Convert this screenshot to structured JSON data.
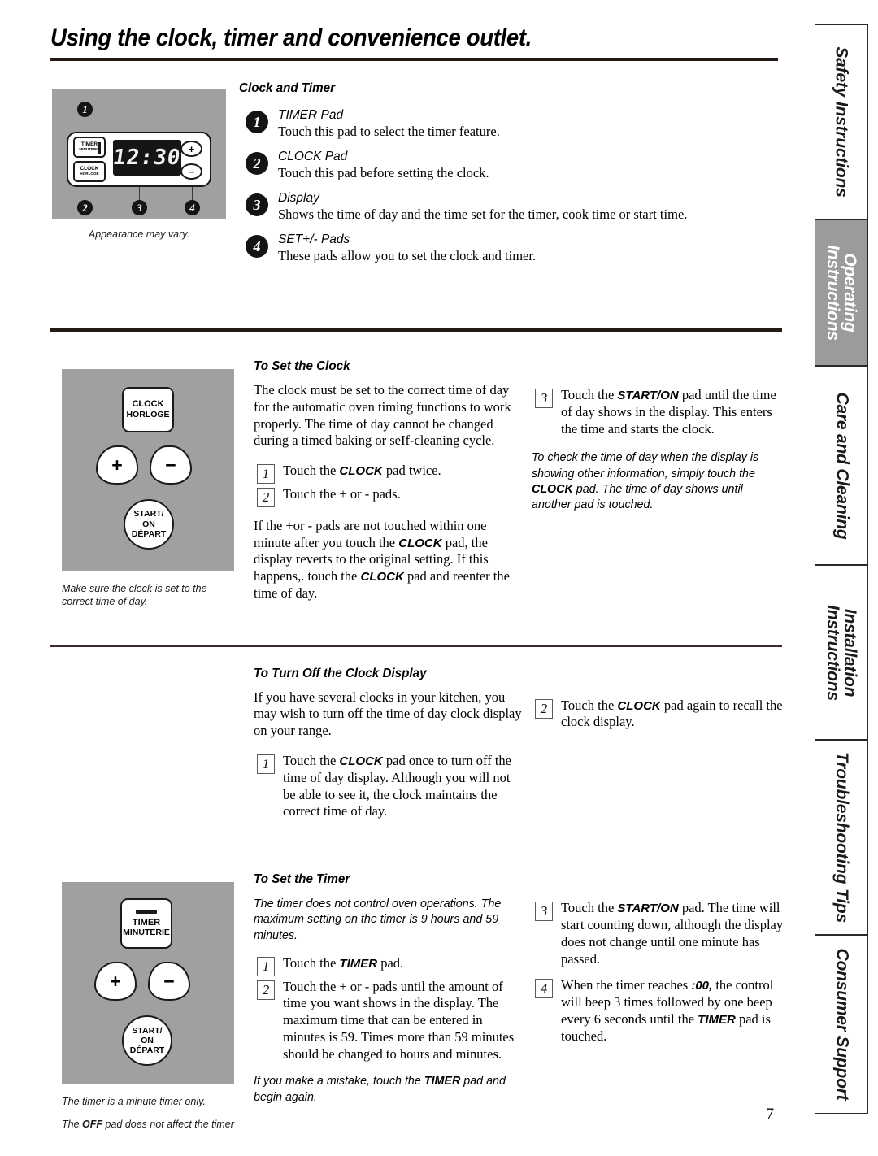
{
  "document": {
    "title": "Using the clock, timer and convenience outlet.",
    "page_number": "7"
  },
  "section_clock_and_timer": {
    "heading": "Clock and Timer",
    "panel": {
      "caption": "Appearance may vary.",
      "timer_pad_line1": "TIMER",
      "timer_pad_line2": "MINUTERIE",
      "clock_pad_line1": "CLOCK",
      "clock_pad_line2": "HORLOGE",
      "display_value": "12:30",
      "plus_symbol": "+",
      "minus_symbol": "−",
      "callout_1": "1",
      "callout_2": "2",
      "callout_3": "3",
      "callout_4": "4"
    },
    "items": [
      {
        "num": "1",
        "head": "TIMER Pad",
        "body": "Touch this pad to select the timer feature."
      },
      {
        "num": "2",
        "head": "CLOCK Pad",
        "body": "Touch this pad before setting the clock."
      },
      {
        "num": "3",
        "head": "Display",
        "body": "Shows the time of day and the time set for the timer, cook time or start time."
      },
      {
        "num": "4",
        "head": "SET+/- Pads",
        "body": "These pads allow you to set the clock and timer."
      }
    ]
  },
  "section_set_clock": {
    "heading": "To Set the Clock",
    "art": {
      "clock_line1": "CLOCK",
      "clock_line2": "HORLOGE",
      "plus_symbol": "+",
      "minus_symbol": "−",
      "start_line1": "START/",
      "start_line2": "ON",
      "start_line3": "DÉPART",
      "caption": "Make sure the clock is set to the correct time of day."
    },
    "intro": "The clock must be set to the correct time of day for the automatic oven timing functions to work properly. The time of day cannot be changed during a timed baking or seIf-cleaning cycle.",
    "step1_num": "1",
    "step1_a": "Touch the ",
    "step1_b": "CLOCK",
    "step1_c": " pad twice.",
    "step2_num": "2",
    "step2_text": "Touch the + or - pads.",
    "note_left_a": "If the +or - pads are not touched within one minute after you touch the ",
    "note_left_b": "CLOCK",
    "note_left_c": " pad, the display reverts to the original setting. If this happens,. touch the ",
    "note_left_d": "CLOCK",
    "note_left_e": " pad and reenter the time of day.",
    "step3_num": "3",
    "step3_a": "Touch the ",
    "step3_b": "START/ON",
    "step3_c": " pad until the time of day shows in the display. This enters the time and starts the clock.",
    "note_right_a": "To check the time of day when the display is showing other information, simply touch the ",
    "note_right_b": "CLOCK",
    "note_right_c": " pad. The time of day shows until another pad is touched."
  },
  "section_turn_off_clock": {
    "heading": "To Turn Off the Clock Display",
    "intro": "If you have several clocks in your kitchen, you may wish to turn off the time of day clock display on your range.",
    "step1_num": "1",
    "step1_a": "Touch the ",
    "step1_b": "CLOCK",
    "step1_c": " pad once to turn off the time of day display. Although you will not be able to see it, the clock maintains the correct time of day.",
    "step2_num": "2",
    "step2_a": "Touch the ",
    "step2_b": "CLOCK",
    "step2_c": " pad again to recall the clock display."
  },
  "section_set_timer": {
    "heading": "To Set the Timer",
    "art": {
      "timer_line1": "TIMER",
      "timer_line2": "MINUTERIE",
      "plus_symbol": "+",
      "minus_symbol": "−",
      "start_line1": "START/",
      "start_line2": "ON",
      "start_line3": "DÉPART",
      "caption1": "The timer is a minute timer only.",
      "caption2_a": "The ",
      "caption2_b": "OFF",
      "caption2_c": " pad does not affect the timer"
    },
    "note_top": "The timer does not control oven operations. The maximum setting on the timer is 9 hours and 59 minutes.",
    "step1_num": "1",
    "step1_a": "Touch the ",
    "step1_b": "TIMER",
    "step1_c": " pad.",
    "step2_num": "2",
    "step2_text": "Touch the + or - pads until the amount of time you want shows in the display. The maximum time that can be entered in minutes is 59. Times more than 59 minutes should be changed to hours and minutes.",
    "note_bottom_a": "If you make a mistake, touch the ",
    "note_bottom_b": "TIMER",
    "note_bottom_c": " pad and begin again.",
    "step3_num": "3",
    "step3_a": "Touch the ",
    "step3_b": "START/ON",
    "step3_c": " pad. The time will start counting down, although the display does not change until one minute has passed.",
    "step4_num": "4",
    "step4_a": "When the timer reaches ",
    "step4_b": ":00,",
    "step4_c": " the control will beep 3 times followed by one beep every 6 seconds until the ",
    "step4_d": "TIMER",
    "step4_e": " pad is touched."
  },
  "sidebar_tabs": [
    {
      "label": "Safety Instructions",
      "shaded": false
    },
    {
      "label": "Operating Instructions",
      "shaded": true
    },
    {
      "label": "Care and Cleaning",
      "shaded": false
    },
    {
      "label": "Installation Instructions",
      "shaded": false
    },
    {
      "label": "Troubleshooting Tips",
      "shaded": false
    },
    {
      "label": "Consumer Support",
      "shaded": false
    }
  ]
}
